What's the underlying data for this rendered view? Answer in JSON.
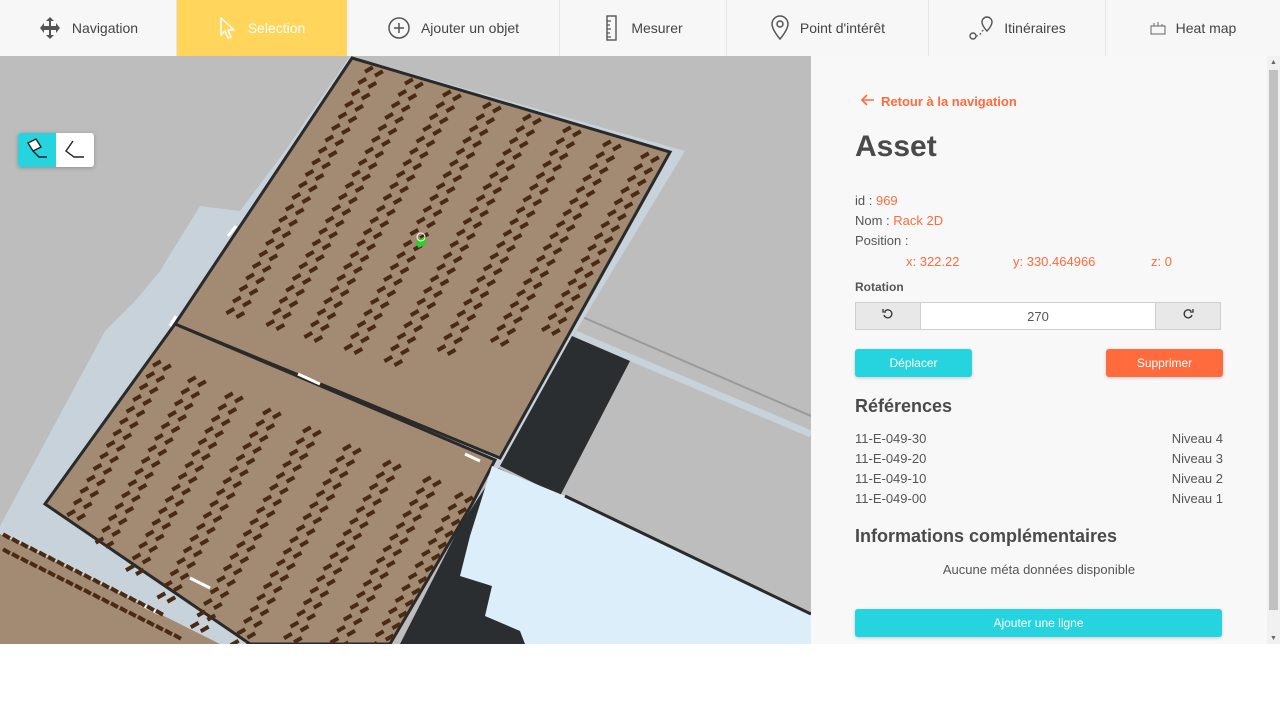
{
  "toolbar": {
    "tools": [
      {
        "label": "Navigation",
        "icon": "move-arrows-icon"
      },
      {
        "label": "Selection",
        "icon": "cursor-pointer-icon"
      },
      {
        "label": "Ajouter un objet",
        "icon": "plus-circle-icon"
      },
      {
        "label": "Mesurer",
        "icon": "ruler-icon"
      },
      {
        "label": "Point d'intérêt",
        "icon": "map-pin-icon"
      },
      {
        "label": "Itinéraires",
        "icon": "route-icon"
      },
      {
        "label": "Heat map",
        "icon": "heatmap-icon"
      }
    ],
    "active_index": 1
  },
  "map": {
    "view_modes": [
      "3d-view-icon",
      "2d-view-icon"
    ],
    "active_mode": 0
  },
  "panel": {
    "back_label": "Retour à la navigation",
    "title": "Asset",
    "id_label": "id :",
    "id_value": "969",
    "name_label": "Nom :",
    "name_value": "Rack 2D",
    "position_label": "Position :",
    "position": {
      "x": "x: 322.22",
      "y": "y: 330.464966",
      "z": "z: 0"
    },
    "rotation_label": "Rotation",
    "rotation_value": "270",
    "move_button": "Déplacer",
    "delete_button": "Supprimer",
    "references_title": "Références",
    "references": [
      {
        "code": "11-E-049-30",
        "level": "Niveau 4"
      },
      {
        "code": "11-E-049-20",
        "level": "Niveau 3"
      },
      {
        "code": "11-E-049-10",
        "level": "Niveau 2"
      },
      {
        "code": "11-E-049-00",
        "level": "Niveau 1"
      }
    ],
    "extra_title": "Informations complémentaires",
    "no_meta": "Aucune méta données disponible",
    "add_line_button": "Ajouter une ligne"
  },
  "colors": {
    "accent": "#26d4df",
    "danger": "#ff6b3d",
    "active_tool": "#ffd55c",
    "floor": "#a38a72",
    "rack": "#4a2a12",
    "corridor": "#c7d2da",
    "dark_zone": "#2b2e31",
    "light_zone": "#ddeefb"
  }
}
